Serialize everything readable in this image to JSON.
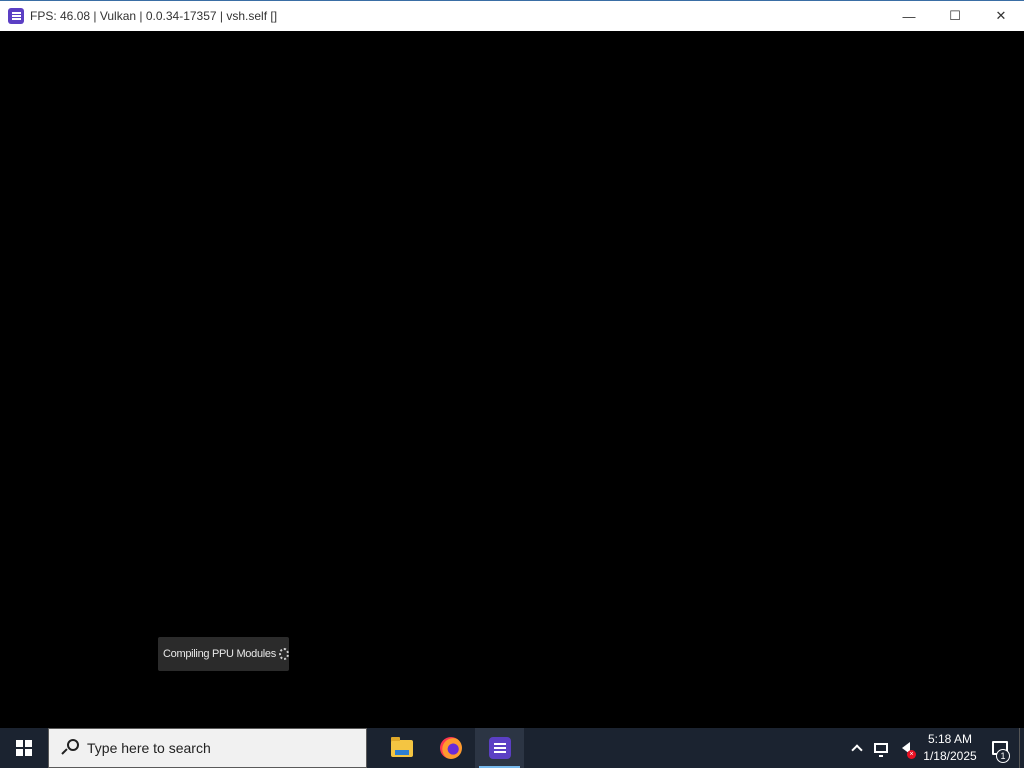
{
  "window": {
    "title": "FPS: 46.08 | Vulkan | 0.0.34-17357 | vsh.self []",
    "app_icon": "rpcs3-icon",
    "controls": {
      "minimize": "—",
      "maximize": "☐",
      "close": "✕"
    }
  },
  "toast": {
    "text": "Compiling PPU Modules",
    "icon": "spinner-icon"
  },
  "taskbar": {
    "start_icon": "windows-logo-icon",
    "search_placeholder": "Type here to search",
    "apps": [
      {
        "name": "File Explorer",
        "icon": "folder-icon",
        "active": false
      },
      {
        "name": "Firefox",
        "icon": "firefox-icon",
        "active": false
      },
      {
        "name": "RPCS3",
        "icon": "rpcs3-icon",
        "active": true
      }
    ],
    "tray": {
      "time": "5:18 AM",
      "date": "1/18/2025",
      "notification_count": "1"
    }
  },
  "colors": {
    "taskbar_bg": "#1b2330",
    "app_accent": "#5b3fc4",
    "toast_bg": "#2b2b2b",
    "active_indicator": "#76b9ed"
  }
}
